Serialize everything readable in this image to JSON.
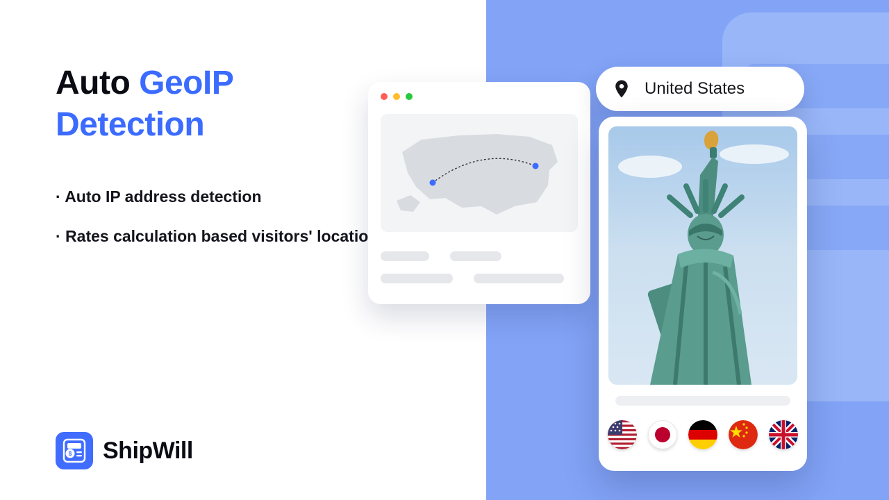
{
  "heading": {
    "word1": "Auto",
    "word2": "GeoIP",
    "word3": "Detection"
  },
  "bullets": {
    "item1": "· Auto IP address detection",
    "item2": "· Rates calculation based visitors' location (GeoIP)"
  },
  "brand": {
    "name": "ShipWill"
  },
  "pill": {
    "country": "United States"
  },
  "icons": {
    "pin": "location-pin-icon",
    "logo": "shipwill-logo-icon"
  },
  "flags": {
    "f1": "us",
    "f2": "jp",
    "f3": "de",
    "f4": "cn",
    "f5": "gb"
  },
  "colors": {
    "accent": "#3b6bff",
    "panel": "#82a3f6"
  }
}
